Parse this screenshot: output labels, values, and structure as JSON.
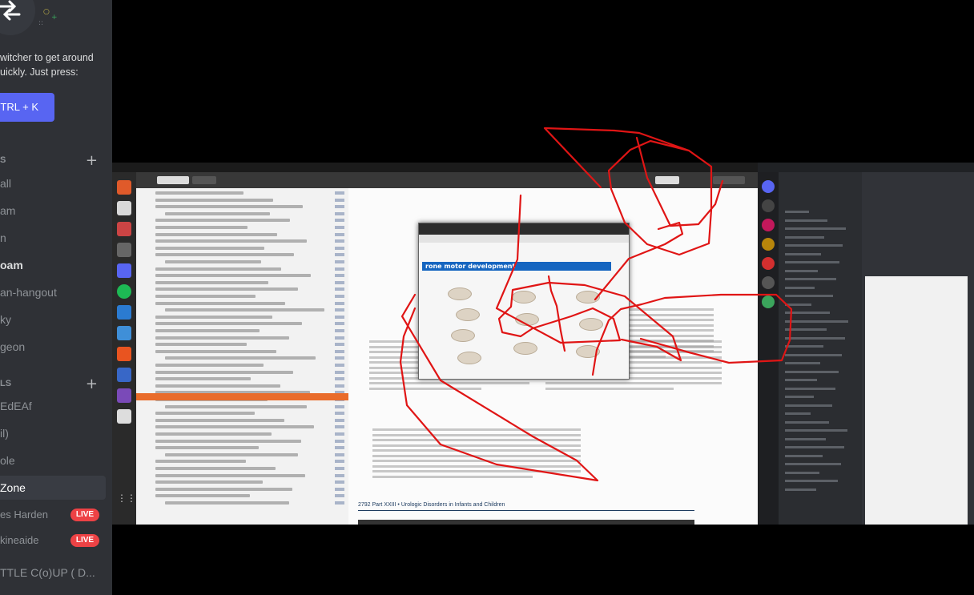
{
  "sidebar": {
    "switcher_text_line1": "witcher to get around",
    "switcher_text_line2": "uickly. Just press:",
    "shortcut_button": "TRL + K",
    "category_1": "S",
    "category_2": "LS",
    "channels": [
      {
        "label": "all"
      },
      {
        "label": "am"
      },
      {
        "label": "n"
      },
      {
        "label": "oam"
      },
      {
        "label": "an-hangout"
      },
      {
        "label": "ky"
      },
      {
        "label": "geon"
      }
    ],
    "voice_channels": [
      {
        "label": "EdEAf"
      },
      {
        "label": "il)"
      },
      {
        "label": "ole"
      },
      {
        "label": "Zone"
      }
    ],
    "streamers": [
      {
        "name": "es Harden",
        "badge": "LIVE"
      },
      {
        "name": "kineaide",
        "badge": "LIVE"
      }
    ],
    "bottom_channel": "TTLE C(o)UP ( D..."
  },
  "stream": {
    "pdf_part_header": "2792   Part XXIII  •  Urologic Disorders in Infants and Children",
    "popup_heading": "rone motor development"
  }
}
